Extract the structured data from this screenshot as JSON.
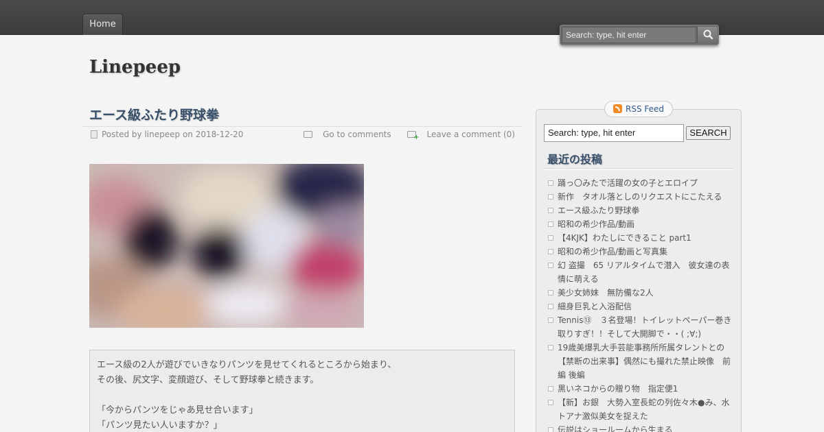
{
  "nav": {
    "home_label": "Home"
  },
  "top_search": {
    "placeholder": "Search: type, hit enter"
  },
  "site": {
    "title": "Linepeep"
  },
  "post": {
    "title": "エース級ふたり野球拳",
    "posted_by_prefix": "Posted by ",
    "author": "linepeep",
    "date_prefix": " on ",
    "date": "2018-12-20",
    "go_to_comments": "Go to comments",
    "leave_comment": "Leave a comment (0)",
    "body_lines": [
      "エース級の2人が遊びでいきなりパンツを見せてくれるところから始まり、",
      "その後、尻文字、変顔遊び、そして野球拳と続きます。",
      "",
      "「今からパンツをじゃあ見せ合います」",
      "「パンツ見たい人いますか？」"
    ]
  },
  "sidebar": {
    "rss_label": "RSS Feed",
    "search_value": "Search: type, hit enter",
    "search_button": "SEARCH",
    "recent_title": "最近の投稿",
    "recent_posts": [
      "踊っ〇みたで活躍の女の子とエロイプ",
      "新作　タオル落としのリクエストにこたえる",
      "エース級ふたり野球拳",
      "昭和の希少作品/動画",
      "【4KJK】わたしにできること part1",
      "昭和の希少作品/動画と写真集",
      "幻 盗撮　65 リアルタイムで潜入　彼女達の表情に萌える",
      "美少女姉妹　無防備な2人",
      "細身巨乳と入浴配信",
      "Tennis⑬　３名登場！トイレットペーパー巻き取りすぎ！！そして大開脚で・・( ;∀;)",
      "19歳美爆乳大手芸能事務所所属タレントとの【禁断の出来事】偶然にも撮れた禁止映像　前編 後編",
      "黒いネコからの贈り物　指定便1",
      "【新】お銀　大勢入室長蛇の列佐々木●み、水トアナ激似美女を捉えた",
      "伝説はショールームから生まる"
    ]
  },
  "colors": {
    "topbar": "#3f3f3f",
    "title_blue": "#38506a",
    "page_bg": "#f4f4f4",
    "rss_orange": "#f08a24"
  },
  "icons": {
    "search": "magnifier-icon",
    "rss": "rss-icon",
    "post_meta": "document-icon",
    "comments": "comment-bubble-icon",
    "add_comment": "add-comment-icon"
  }
}
